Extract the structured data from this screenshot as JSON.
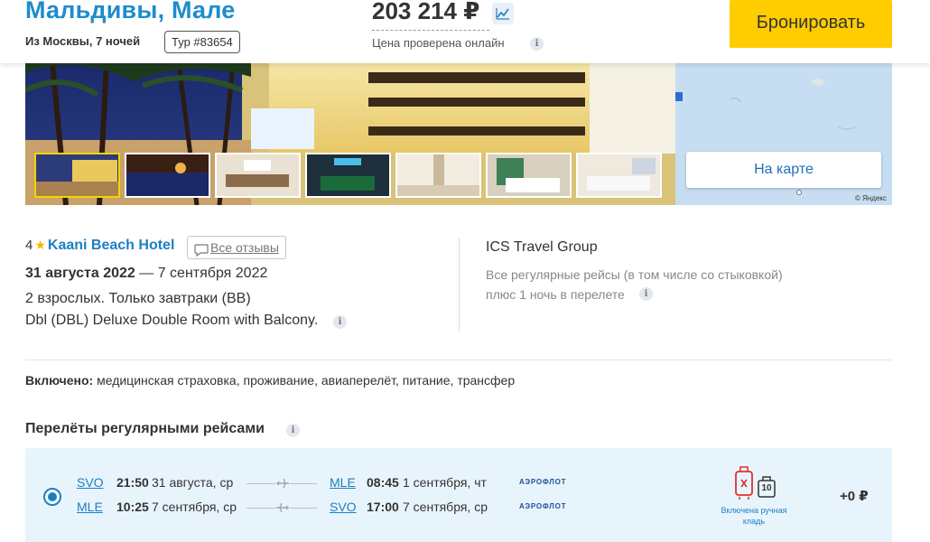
{
  "header": {
    "title": "Мальдивы, Мале",
    "subtitle": "Из Москвы, 7 ночей",
    "tour_number": "Тур #83654",
    "price": "203 214 ₽",
    "price_note": "Цена проверена онлайн",
    "book_label": "Бронировать"
  },
  "map": {
    "button_label": "На карте",
    "copyright": "© Яндекс"
  },
  "hotel": {
    "stars": "4",
    "name": "Kaani Beach Hotel",
    "reviews_label": "Все отзывы",
    "date_from": "31 августа 2022",
    "date_to": "— 7 сентября 2022",
    "guests_meal": "2 взрослых. Только завтраки (BB)",
    "room": "Dbl (DBL) Deluxe Double Room with Balcony."
  },
  "operator": {
    "name": "ICS Travel Group",
    "note1": "Все регулярные рейсы (в том числе со стыковкой)",
    "note2": "плюс 1 ночь в перелете"
  },
  "included": {
    "label": "Включено:",
    "text": "медицинская страховка, проживание, авиаперелёт, питание, трансфер"
  },
  "flights": {
    "section_title": "Перелёты регулярными рейсами",
    "options": [
      {
        "selected": true,
        "segments": [
          {
            "from": "SVO",
            "dep_time": "21:50",
            "dep_date": "31 августа, ср",
            "to": "MLE",
            "arr_time": "08:45",
            "arr_date": "1 сентября, чт",
            "airline": "АЭРОФЛОТ"
          },
          {
            "from": "MLE",
            "dep_time": "10:25",
            "dep_date": "7 сентября, ср",
            "to": "SVO",
            "arr_time": "17:00",
            "arr_date": "7 сентября, ср",
            "airline": "АЭРОФЛОТ"
          }
        ],
        "baggage_note": "Включена ручная кладь",
        "hand_luggage_kg": "10",
        "extra_price": "+0 ₽"
      }
    ]
  },
  "colors": {
    "accent": "#1d8ccc",
    "book_button": "#ffcc00",
    "flight_card_bg": "#e8f4fc",
    "star": "#f5b400"
  },
  "icons": [
    "chart-icon",
    "info-icon",
    "star-icon",
    "speech-bubble-icon",
    "plane-icon",
    "suitcase-crossed-icon",
    "hand-luggage-icon"
  ]
}
